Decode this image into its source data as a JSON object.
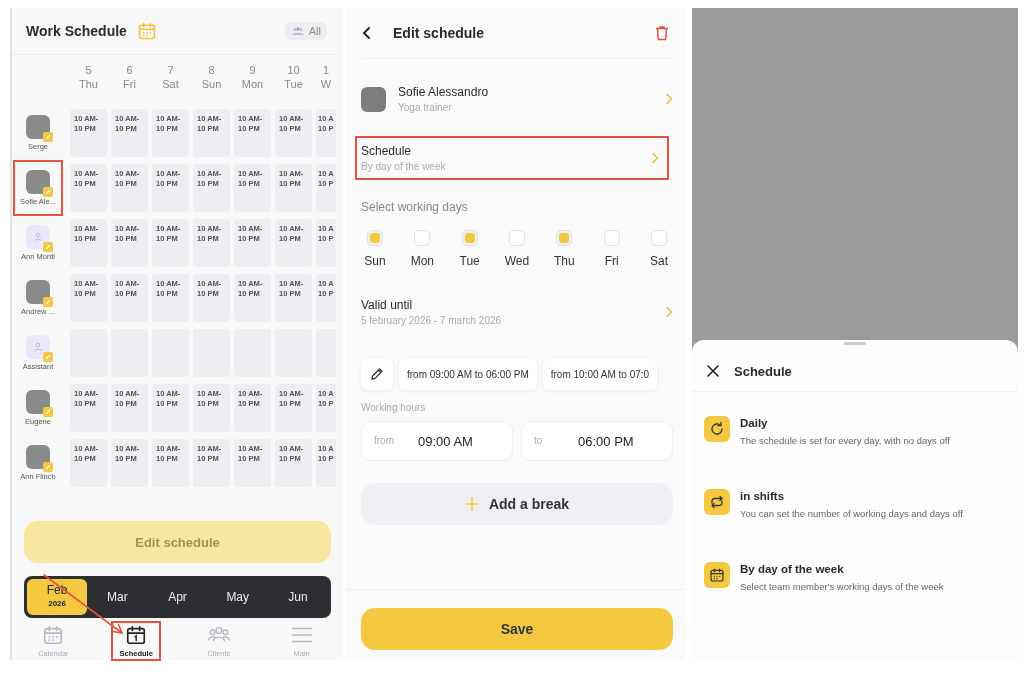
{
  "work_schedule": {
    "title": "Work Schedule",
    "filter": {
      "label": "All"
    },
    "days": [
      {
        "date": "5",
        "weekday": "Thu"
      },
      {
        "date": "6",
        "weekday": "Fri"
      },
      {
        "date": "7",
        "weekday": "Sat"
      },
      {
        "date": "8",
        "weekday": "Sun"
      },
      {
        "date": "9",
        "weekday": "Mon"
      },
      {
        "date": "10",
        "weekday": "Tue"
      },
      {
        "date": "1",
        "weekday": "W"
      }
    ],
    "employees": [
      {
        "name": "Serge",
        "photo": true,
        "highlighted": false,
        "shifts": [
          "10 AM-10 PM",
          "10 AM-10 PM",
          "10 AM-10 PM",
          "10 AM-10 PM",
          "10 AM-10 PM",
          "10 AM-10 PM",
          "10 A 10 P"
        ]
      },
      {
        "name": "Sofie Ale...",
        "photo": true,
        "highlighted": true,
        "shifts": [
          "10 AM-10 PM",
          "10 AM-10 PM",
          "10 AM-10 PM",
          "10 AM-10 PM",
          "10 AM-10 PM",
          "10 AM-10 PM",
          "10 A 10 P"
        ]
      },
      {
        "name": "Ann Monti",
        "photo": false,
        "highlighted": false,
        "shifts": [
          "10 AM-10 PM",
          "10 AM-10 PM",
          "10 AM-10 PM",
          "10 AM-10 PM",
          "10 AM-10 PM",
          "10 AM-10 PM",
          "10 A 10 P"
        ]
      },
      {
        "name": "Andrew ...",
        "photo": true,
        "highlighted": false,
        "shifts": [
          "10 AM-10 PM",
          "10 AM-10 PM",
          "10 AM-10 PM",
          "10 AM-10 PM",
          "10 AM-10 PM",
          "10 AM-10 PM",
          "10 A 10 P"
        ]
      },
      {
        "name": "Assistant",
        "photo": false,
        "highlighted": false
      },
      {
        "name": "Eugene",
        "photo": true,
        "highlighted": false,
        "shifts": [
          "10 AM-10 PM",
          "10 AM-10 PM",
          "10 AM-10 PM",
          "10 AM-10 PM",
          "10 AM-10 PM",
          "10 AM-10 PM",
          "10 A 10 P"
        ]
      },
      {
        "name": "Ann Flinch",
        "photo": true,
        "highlighted": false,
        "shifts": [
          "10 AM-10 PM",
          "10 AM-10 PM",
          "10 AM-10 PM",
          "10 AM-10 PM",
          "10 AM-10 PM",
          "10 AM-10 PM",
          "10 A 10 P"
        ]
      }
    ],
    "edit_button": {
      "label": "Edit schedule",
      "disabled": true
    },
    "months": [
      {
        "label": "Feb",
        "year": "2026",
        "selected": true
      },
      {
        "label": "Mar",
        "selected": false
      },
      {
        "label": "Apr",
        "selected": false
      },
      {
        "label": "May",
        "selected": false
      },
      {
        "label": "Jun",
        "selected": false
      }
    ],
    "nav": [
      {
        "label": "Calendar",
        "selected": false,
        "highlighted": false
      },
      {
        "label": "Schedule",
        "selected": true,
        "highlighted": true
      },
      {
        "label": "Clients",
        "selected": false,
        "highlighted": false
      },
      {
        "label": "Main",
        "selected": false,
        "highlighted": false
      }
    ]
  },
  "edit_schedule": {
    "title": "Edit schedule",
    "member": {
      "name": "Sofie Alessandro",
      "role": "Yoga trainer"
    },
    "schedule_row": {
      "label": "Schedule",
      "value": "By day of the week",
      "highlighted": true
    },
    "working_days_label": "Select working days",
    "days": [
      {
        "label": "Sun",
        "checked": true
      },
      {
        "label": "Mon",
        "checked": false
      },
      {
        "label": "Tue",
        "checked": true
      },
      {
        "label": "Wed",
        "checked": false
      },
      {
        "label": "Thu",
        "checked": true
      },
      {
        "label": "Fri",
        "checked": false
      },
      {
        "label": "Sat",
        "checked": false
      }
    ],
    "valid_until": {
      "label": "Valid until",
      "value": "5 february 2026 - 7 march 2026"
    },
    "presets": [
      "from 09:00 AM to 06:00 PM",
      "from 10:00 AM to 07:0"
    ],
    "working_hours": {
      "label": "Working hours",
      "from": {
        "label": "from",
        "value": "09:00 AM"
      },
      "to": {
        "label": "to",
        "value": "06:00 PM"
      }
    },
    "add_break": "Add a break",
    "save": "Save"
  },
  "schedule_sheet": {
    "title": "Schedule",
    "options": [
      {
        "title": "Daily",
        "description": "The schedule is set for every day, with no days off"
      },
      {
        "title": "in shifts",
        "description": "You can set the number of working days and days off"
      },
      {
        "title": "By day of the week",
        "description": "Select team member's working days of the week"
      }
    ]
  }
}
